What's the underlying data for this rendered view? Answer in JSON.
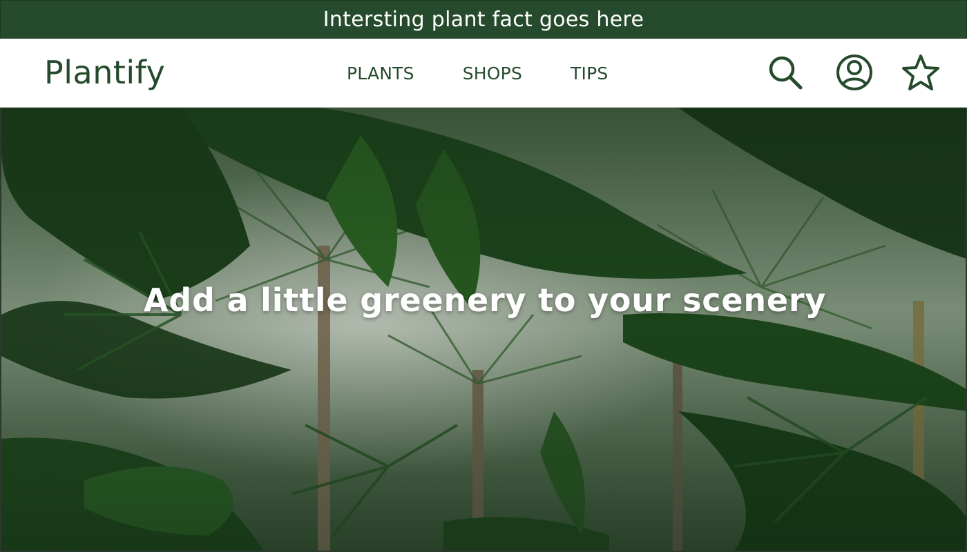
{
  "announcement": {
    "text": "Intersting plant fact goes here"
  },
  "header": {
    "logo": "Plantify",
    "nav": [
      {
        "label": "PLANTS"
      },
      {
        "label": "SHOPS"
      },
      {
        "label": "TIPS"
      }
    ],
    "icons": [
      "search-icon",
      "account-icon",
      "favorites-star-icon"
    ]
  },
  "hero": {
    "title": "Add a little greenery to your scenery",
    "image": "tropical-greenhouse-foliage"
  },
  "colors": {
    "brand_dark_green": "#264b2c",
    "header_bg": "#ffffff",
    "hero_text": "#ffffff"
  }
}
